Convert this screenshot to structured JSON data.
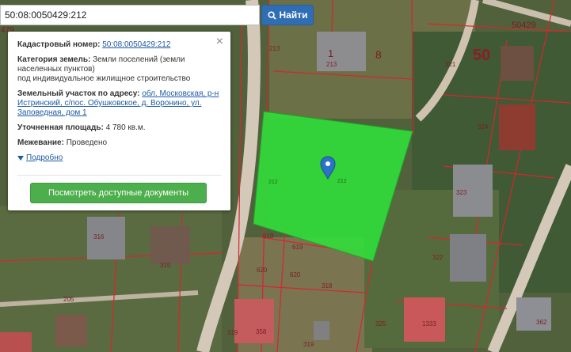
{
  "search": {
    "value": "50:08:0050429:212",
    "button_label": "Найти"
  },
  "info": {
    "cadastral_label": "Кадастровый номер:",
    "cadastral_value": "50:08:0050429:212",
    "category_label": "Категория земель:",
    "category_value": "Земли поселений (земли населенных пунктов)",
    "usage": "под индивидуальное жилищное строительство",
    "address_label": "Земельный участок по адресу:",
    "address_value": "обл. Московская, р-н Истринский, с/пос. Обушковское, д. Воронино, ул. Заповедная, дом 1",
    "area_label": "Уточненная площадь:",
    "area_value": "4 780 кв.м.",
    "survey_label": "Межевание:",
    "survey_value": "Проведено",
    "more_label": "Подробно",
    "docs_button": "Посмотреть доступные документы"
  },
  "map": {
    "block_number": "50",
    "block_code": "50429",
    "edge_label": "479",
    "parcel_labels": [
      "1",
      "8",
      "213",
      "213",
      "321",
      "324",
      "323",
      "322",
      "316",
      "315",
      "212",
      "212",
      "619",
      "619",
      "620",
      "620",
      "318",
      "325",
      "205",
      "319",
      "358",
      "319",
      "362",
      "1333"
    ],
    "colors": {
      "selected_parcel": "#2fe03a",
      "boundary": "#d8252f",
      "road": "#d4c8b8",
      "search_button": "#2f6db5",
      "docs_button": "#4cae4c",
      "marker": "#2b73c6"
    }
  }
}
